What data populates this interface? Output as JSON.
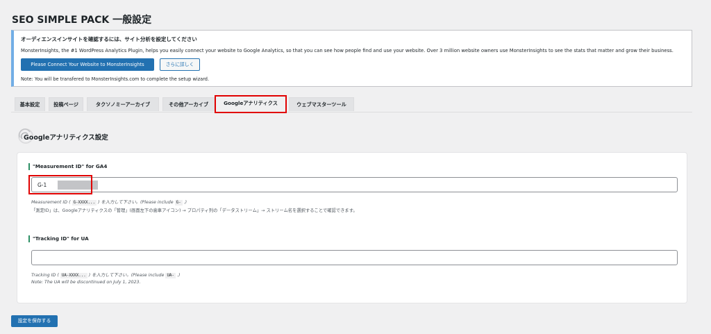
{
  "page": {
    "title": "SEO SIMPLE PACK 一般設定"
  },
  "notice": {
    "title": "オーディエンスインサイトを確認するには、サイト分析を設定してください",
    "description": "MonsterInsights, the #1 WordPress Analytics Plugin, helps you easily connect your website to Google Analytics, so that you can see how people find and use your website. Over 3 million website owners use MonsterInsights to see the stats that matter and grow their business.",
    "connect_button": "Please Connect Your Website to MonsterInsights",
    "learn_more_button": "さらに詳しく",
    "note": "Note: You will be transfered to MonsterInsights.com to complete the setup wizard."
  },
  "tabs": [
    {
      "label": "基本設定",
      "active": false
    },
    {
      "label": "投稿ページ",
      "active": false
    },
    {
      "label": "タクソノミーアーカイブ",
      "active": false
    },
    {
      "label": "その他アーカイブ",
      "active": false
    },
    {
      "label": "Googleアナリティクス",
      "active": true
    },
    {
      "label": "ウェブマスターツール",
      "active": false
    }
  ],
  "section": {
    "title": "Googleアナリティクス設定"
  },
  "ga4": {
    "label": "\"Measurement ID\" for GA4",
    "value": "G-1",
    "help_prefix": "Measurement ID (",
    "help_code1": "G-XXXX...",
    "help_mid": ") を入力して下さい。(Please include",
    "help_code2": "G-",
    "help_suffix": ".)",
    "help_line2": "「測定ID」は、Googleアナリティクスの「管理」(画面左下の歯車アイコン) → プロパティ列の「データストリーム」→ ストリーム名を選択することで確認できます。"
  },
  "ua": {
    "label": "\"Tracking ID\" for UA",
    "value": "",
    "help_prefix": "Tracking ID (",
    "help_code1": "UA-XXXX...",
    "help_mid": ") を入力して下さい。(Please include",
    "help_code2": "UA-",
    "help_suffix": ".)",
    "help_line2": "Note: The UA will be discontinued on July 1, 2023."
  },
  "save_button": "設定を保存する",
  "colors": {
    "primary": "#2271b1",
    "highlight": "#e10000",
    "accent": "#2c8f64"
  }
}
